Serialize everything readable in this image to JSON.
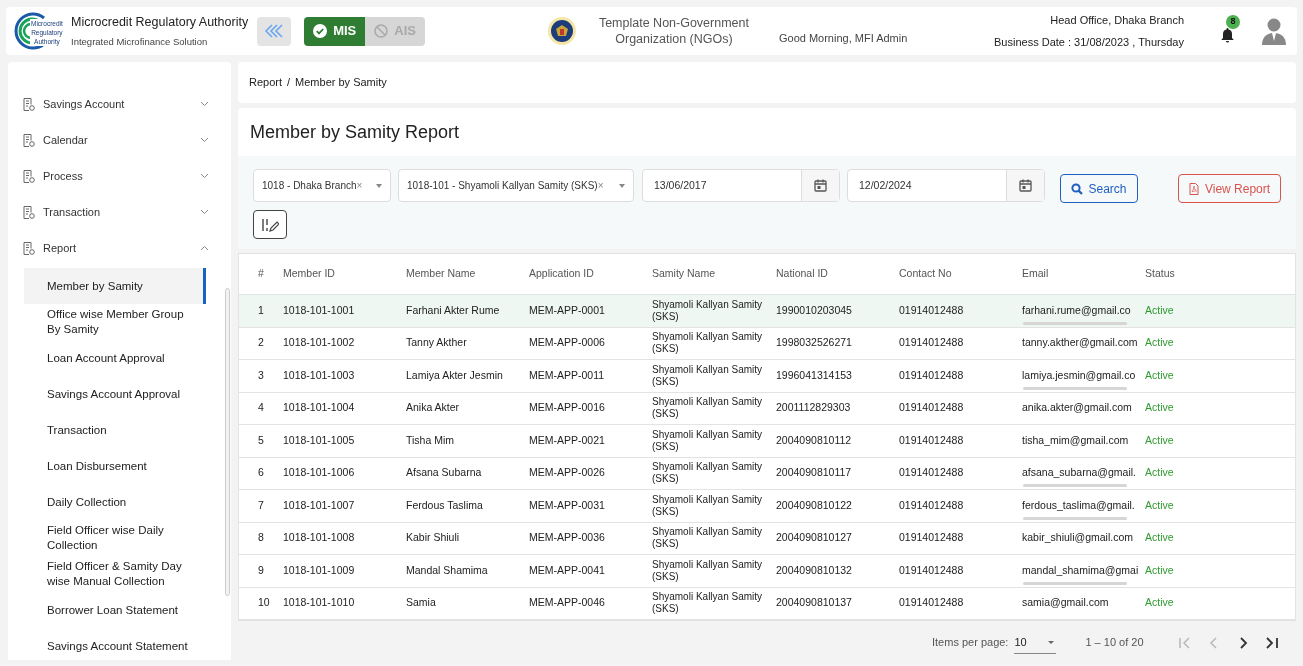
{
  "header": {
    "org_title": "Microcredit Regulatory Authority",
    "org_subtitle": "Integrated Microfinance Solution",
    "logo_text": [
      "Microcredit",
      "Regulatory",
      "Authority"
    ],
    "modules": [
      {
        "label": "MIS",
        "selected": true
      },
      {
        "label": "AIS",
        "selected": false
      }
    ],
    "ngo_name": "Template Non-Government Organization (NGOs)",
    "greeting": "Good Morning, MFI Admin",
    "branch": "Head Office, Dhaka Branch",
    "business_date": "Business Date : 31/08/2023 , Thursday",
    "notification_count": "8"
  },
  "sidebar": {
    "items": [
      {
        "label": "Savings Account",
        "expanded": false
      },
      {
        "label": "Calendar",
        "expanded": false
      },
      {
        "label": "Process",
        "expanded": false
      },
      {
        "label": "Transaction",
        "expanded": false
      },
      {
        "label": "Report",
        "expanded": true,
        "children": [
          {
            "label": "Member by Samity",
            "selected": true
          },
          {
            "label": "Office wise Member Group By Samity",
            "selected": false
          },
          {
            "label": "Loan Account Approval",
            "selected": false
          },
          {
            "label": "Savings Account Approval",
            "selected": false
          },
          {
            "label": "Transaction",
            "selected": false
          },
          {
            "label": "Loan Disbursement",
            "selected": false
          },
          {
            "label": "Daily Collection",
            "selected": false
          },
          {
            "label": "Field Officer wise Daily Collection",
            "selected": false
          },
          {
            "label": "Field Officer & Samity Day wise Manual Collection",
            "selected": false
          },
          {
            "label": "Borrower Loan Statement",
            "selected": false
          },
          {
            "label": "Savings Account Statement",
            "selected": false
          }
        ]
      }
    ]
  },
  "breadcrumb": {
    "items": [
      "Report",
      "Member by Samity"
    ],
    "separator": "/"
  },
  "page_title": "Member by Samity Report",
  "filters": {
    "branch": "1018 - Dhaka Branch",
    "samity": "1018-101 - Shyamoli Kallyan Samity (SKS)",
    "date_from": "13/06/2017",
    "date_to": "12/02/2024",
    "clear_mark": "×",
    "search_button": "Search",
    "report_button": "View Report"
  },
  "table": {
    "columns": [
      "#",
      "Member ID",
      "Member Name",
      "Application ID",
      "Samity Name",
      "National ID",
      "Contact No",
      "Email",
      "Status"
    ],
    "rows": [
      {
        "cells": [
          "1",
          "1018-101-1001",
          "Farhani Akter Rume",
          "MEM-APP-0001",
          "Shyamoli Kallyan Samity (SKS)",
          "1990010203045",
          "01914012488",
          "farhani.rume@gmail.co",
          "Active"
        ],
        "email_cut": true,
        "selected": true
      },
      {
        "cells": [
          "2",
          "1018-101-1002",
          "Tanny Akther",
          "MEM-APP-0006",
          "Shyamoli Kallyan Samity (SKS)",
          "1998032526271",
          "01914012488",
          "tanny.akther@gmail.com",
          "Active"
        ],
        "email_cut": false,
        "selected": false
      },
      {
        "cells": [
          "3",
          "1018-101-1003",
          "Lamiya Akter Jesmin",
          "MEM-APP-0011",
          "Shyamoli Kallyan Samity (SKS)",
          "1996041314153",
          "01914012488",
          "lamiya.jesmin@gmail.co",
          "Active"
        ],
        "email_cut": true,
        "selected": false
      },
      {
        "cells": [
          "4",
          "1018-101-1004",
          "Anika Akter",
          "MEM-APP-0016",
          "Shyamoli Kallyan Samity (SKS)",
          "2001112829303",
          "01914012488",
          "anika.akter@gmail.com",
          "Active"
        ],
        "email_cut": false,
        "selected": false
      },
      {
        "cells": [
          "5",
          "1018-101-1005",
          "Tisha Mim",
          "MEM-APP-0021",
          "Shyamoli Kallyan Samity (SKS)",
          "2004090810112",
          "01914012488",
          "tisha_mim@gmail.com",
          "Active"
        ],
        "email_cut": false,
        "selected": false
      },
      {
        "cells": [
          "6",
          "1018-101-1006",
          "Afsana Subarna",
          "MEM-APP-0026",
          "Shyamoli Kallyan Samity (SKS)",
          "2004090810117",
          "01914012488",
          "afsana_subarna@gmail.",
          "Active"
        ],
        "email_cut": true,
        "selected": false
      },
      {
        "cells": [
          "7",
          "1018-101-1007",
          "Ferdous Taslima",
          "MEM-APP-0031",
          "Shyamoli Kallyan Samity (SKS)",
          "2004090810122",
          "01914012488",
          "ferdous_taslima@gmail.",
          "Active"
        ],
        "email_cut": true,
        "selected": false
      },
      {
        "cells": [
          "8",
          "1018-101-1008",
          "Kabir Shiuli",
          "MEM-APP-0036",
          "Shyamoli Kallyan Samity (SKS)",
          "2004090810127",
          "01914012488",
          "kabir_shiuli@gmail.com",
          "Active"
        ],
        "email_cut": false,
        "selected": false
      },
      {
        "cells": [
          "9",
          "1018-101-1009",
          "Mandal Shamima",
          "MEM-APP-0041",
          "Shyamoli Kallyan Samity (SKS)",
          "2004090810132",
          "01914012488",
          "mandal_shamima@gmai",
          "Active"
        ],
        "email_cut": true,
        "selected": false
      },
      {
        "cells": [
          "10",
          "1018-101-1010",
          "Samia",
          "MEM-APP-0046",
          "Shyamoli Kallyan Samity (SKS)",
          "2004090810137",
          "01914012488",
          "samia@gmail.com",
          "Active"
        ],
        "email_cut": false,
        "selected": false
      }
    ]
  },
  "pagination": {
    "label": "Items per page:",
    "page_size": "10",
    "range": "1 – 10 of 20"
  }
}
